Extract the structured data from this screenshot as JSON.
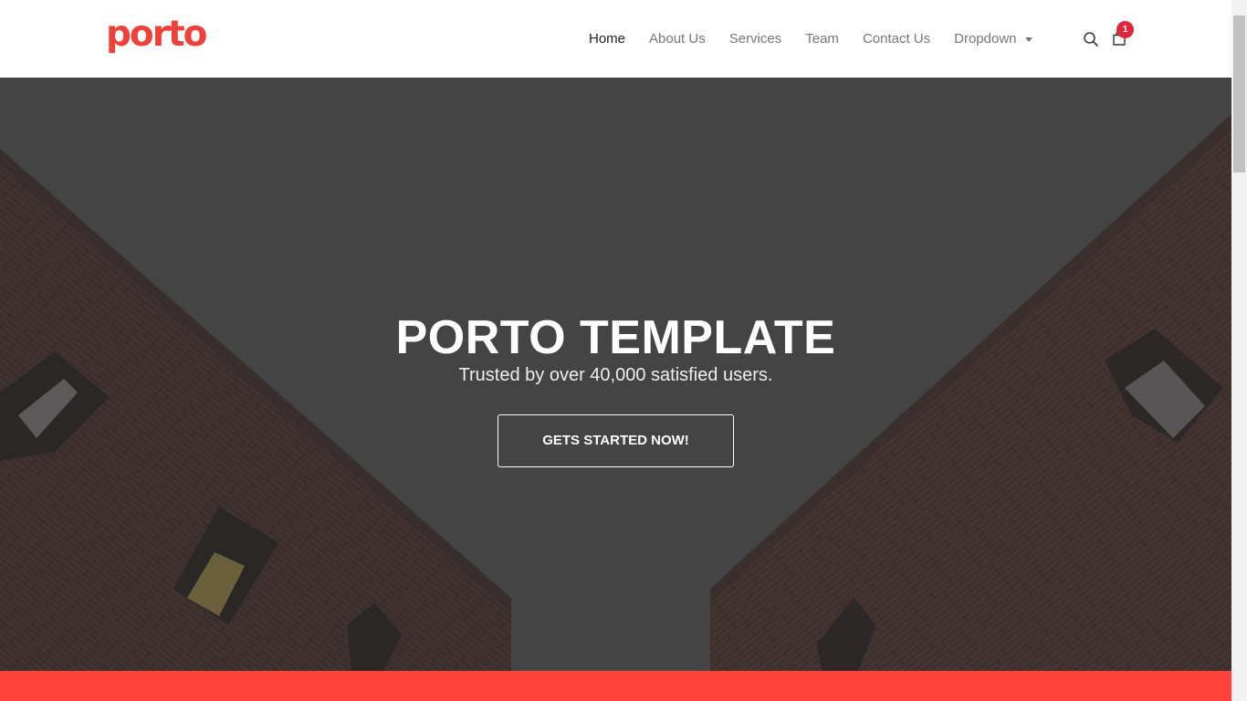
{
  "brand": {
    "logo_text": "porto",
    "accent_color": "#f0403a"
  },
  "nav": {
    "items": [
      {
        "label": "Home",
        "active": true
      },
      {
        "label": "About Us",
        "active": false
      },
      {
        "label": "Services",
        "active": false
      },
      {
        "label": "Team",
        "active": false
      },
      {
        "label": "Contact Us",
        "active": false
      },
      {
        "label": "Dropdown",
        "active": false,
        "has_caret": true
      }
    ]
  },
  "header_icons": {
    "search": "search-icon",
    "cart": "shopping-bag-icon",
    "cart_count": "1",
    "badge_color": "#e0283d"
  },
  "hero": {
    "title": "PORTO TEMPLATE",
    "subtitle": "Trusted by over 40,000 satisfied users.",
    "cta_label": "GETS STARTED NOW!",
    "overlay_color": "#464446"
  },
  "footer_band": {
    "color": "#ff433b"
  }
}
